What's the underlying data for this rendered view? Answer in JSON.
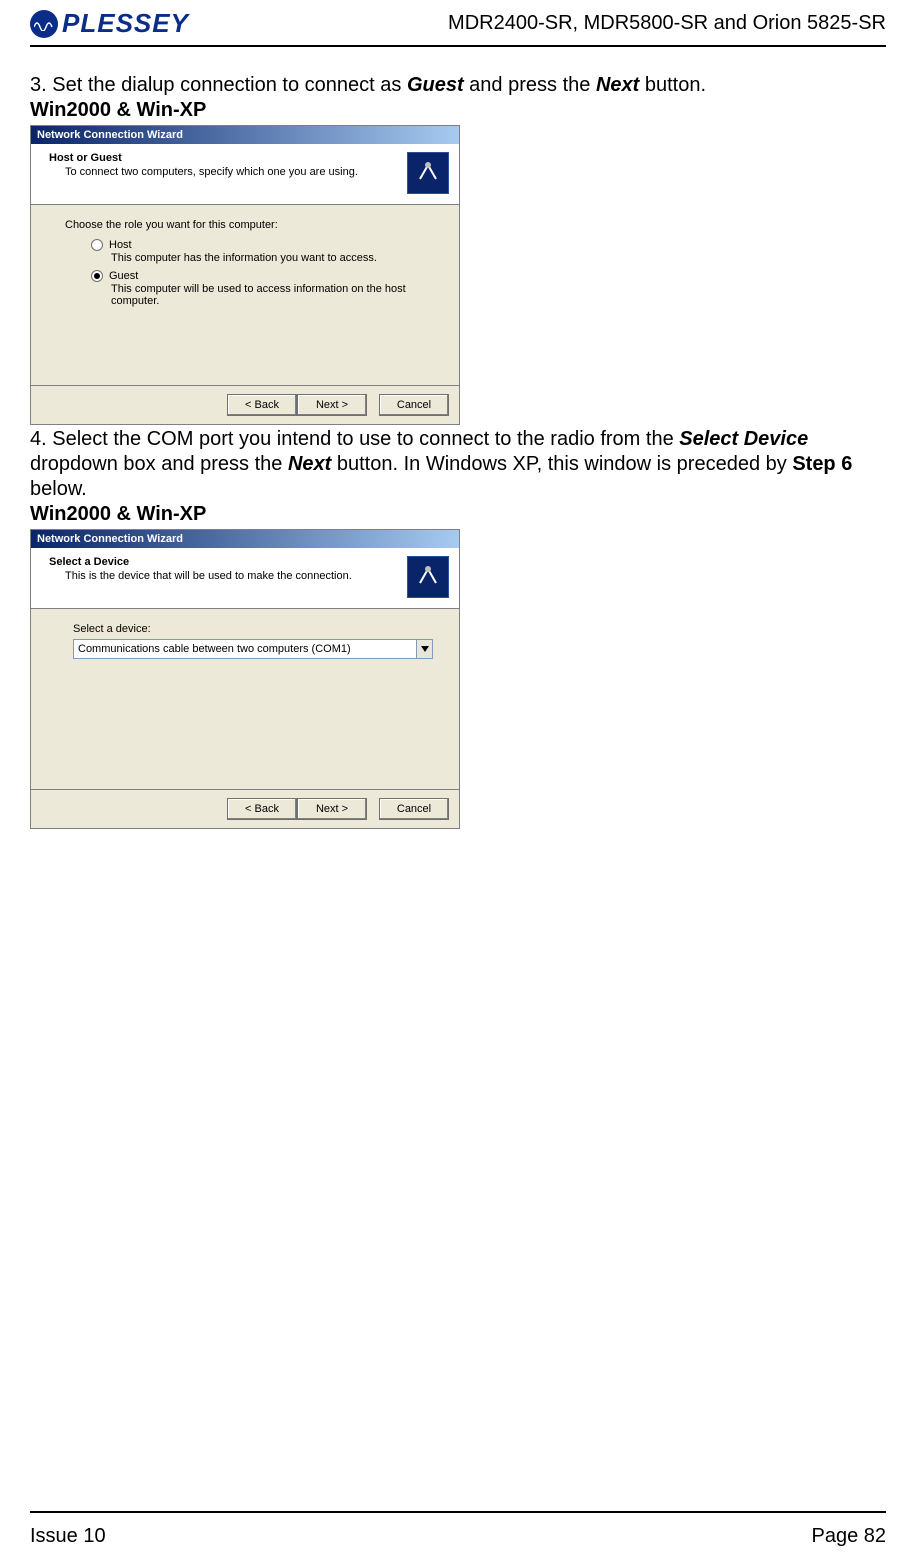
{
  "header": {
    "brand": "PLESSEY",
    "models": "MDR2400-SR, MDR5800-SR and Orion 5825-SR"
  },
  "step3": {
    "prefix": "3. Set the dialup connection to connect as ",
    "guest": "Guest",
    "mid": " and press the ",
    "next": "Next",
    "suffix": " button.",
    "os_label": "Win2000 & Win-XP"
  },
  "step4": {
    "prefix": "4. Select the COM port you intend to use to connect to the radio from the ",
    "select_device": "Select Device",
    "mid1": " dropdown box and press the ",
    "next": "Next",
    "mid2": " button.  In Windows XP, this window is preceded by ",
    "step6": "Step 6",
    "suffix": " below.",
    "os_label": "Win2000 & Win-XP"
  },
  "wizard1": {
    "title": "Network Connection Wizard",
    "head_title": "Host or Guest",
    "head_sub": "To connect two computers, specify which one you are using.",
    "prompt": "Choose the role you want for this computer:",
    "opt_host": "Host",
    "opt_host_desc": "This computer has the information you want to access.",
    "opt_guest": "Guest",
    "opt_guest_desc": "This computer will be used to access information on the host computer.",
    "btn_back": "< Back",
    "btn_next": "Next >",
    "btn_cancel": "Cancel"
  },
  "wizard2": {
    "title": "Network Connection Wizard",
    "head_title": "Select a Device",
    "head_sub": "This is the device that will be used to make the connection.",
    "select_label": "Select a device:",
    "select_value": "Communications cable between two computers (COM1)",
    "btn_back": "< Back",
    "btn_next": "Next >",
    "btn_cancel": "Cancel"
  },
  "footer": {
    "issue": "Issue 10",
    "page": "Page 82"
  }
}
